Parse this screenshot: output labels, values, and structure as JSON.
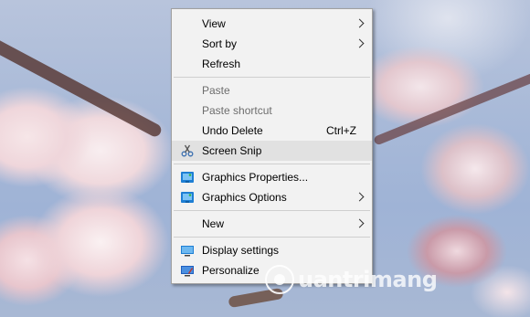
{
  "context_menu": {
    "items": [
      {
        "label": "View",
        "submenu": true
      },
      {
        "label": "Sort by",
        "submenu": true
      },
      {
        "label": "Refresh"
      },
      {
        "label": "Paste",
        "disabled": true
      },
      {
        "label": "Paste shortcut",
        "disabled": true
      },
      {
        "label": "Undo Delete",
        "shortcut": "Ctrl+Z"
      },
      {
        "label": "Screen Snip",
        "icon": "scissors-icon",
        "highlighted": true
      },
      {
        "label": "Graphics Properties...",
        "icon": "intel-graphics-icon"
      },
      {
        "label": "Graphics Options",
        "icon": "intel-graphics-icon",
        "submenu": true
      },
      {
        "label": "New",
        "submenu": true
      },
      {
        "label": "Display settings",
        "icon": "display-icon"
      },
      {
        "label": "Personalize",
        "icon": "personalize-icon"
      }
    ]
  },
  "watermark": {
    "text": "uantrimang"
  },
  "colors": {
    "menu_bg": "#f2f2f2",
    "highlight_bg": "#e1e1e1",
    "disabled_text": "#6d6d6d",
    "icon_blue": "#1e7fd4"
  }
}
